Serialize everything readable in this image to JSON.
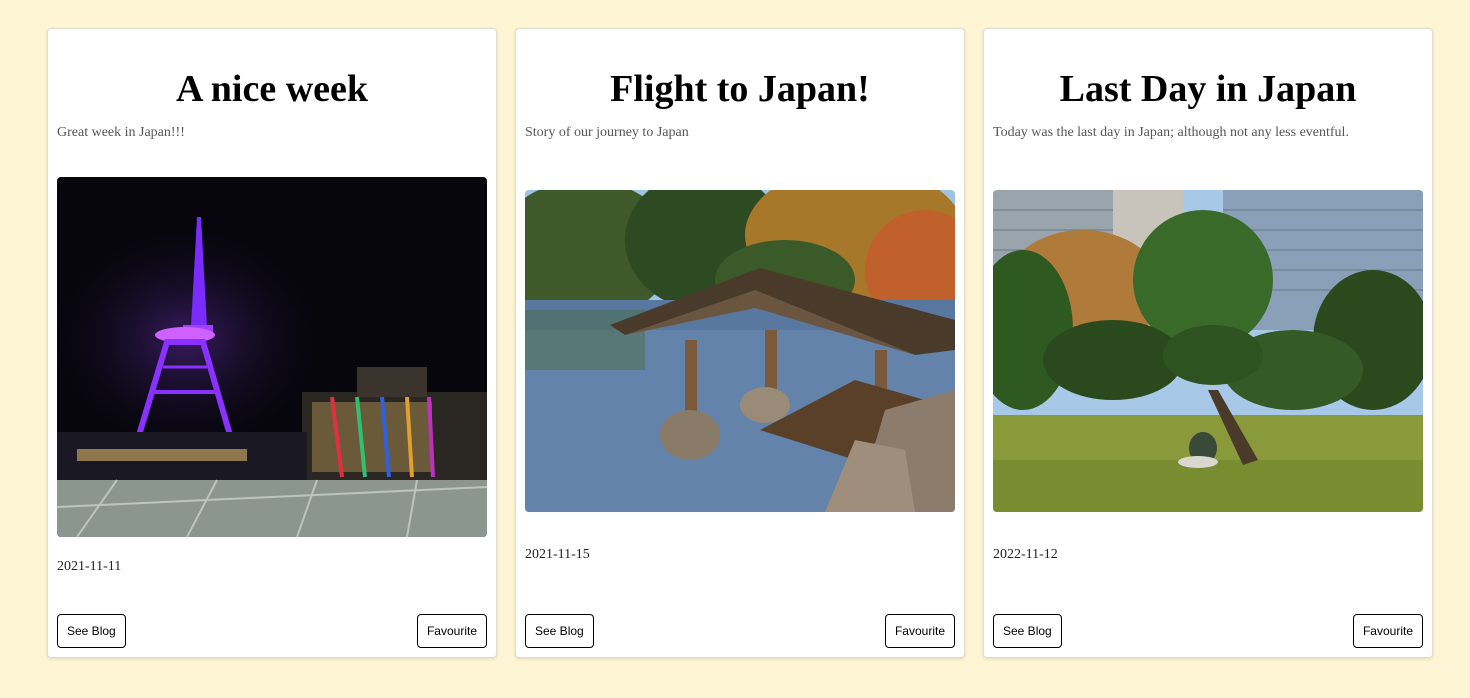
{
  "page": {
    "background": "#fdf5d3"
  },
  "cards": [
    {
      "title": "A nice week",
      "description": "Great week in Japan!!!",
      "image": "nagoya-tv-tower-night-photo",
      "date": "2021-11-11",
      "see_blog_label": "See Blog",
      "favourite_label": "Favourite"
    },
    {
      "title": "Flight to Japan!",
      "description": "Story of our journey to Japan",
      "image": "garden-pond-wooden-boathouse-photo",
      "date": "2021-11-15",
      "see_blog_label": "See Blog",
      "favourite_label": "Favourite"
    },
    {
      "title": "Last Day in Japan",
      "description": "Today was the last day in Japan; although not any less eventful.",
      "image": "park-pine-trees-city-photo",
      "date": "2022-11-12",
      "see_blog_label": "See Blog",
      "favourite_label": "Favourite"
    }
  ]
}
